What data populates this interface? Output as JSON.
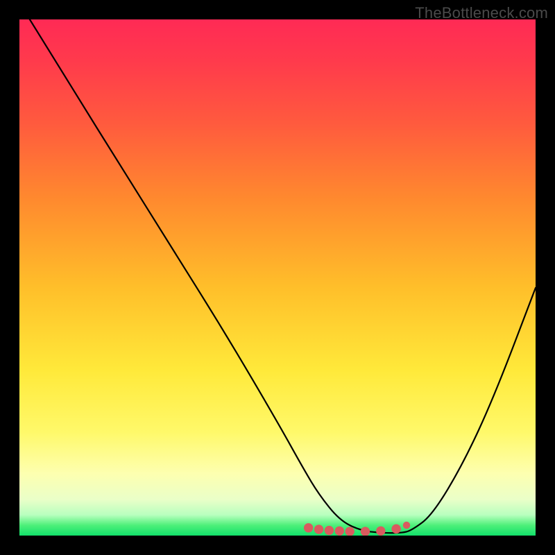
{
  "watermark": "TheBottleneck.com",
  "colors": {
    "frame": "#000000",
    "curve": "#000000",
    "marker_fill": "#d95b5f",
    "marker_stroke": "#d95b5f",
    "gradient_top": "#ff2a55",
    "gradient_bottom": "#12e06a"
  },
  "chart_data": {
    "type": "line",
    "title": "",
    "xlabel": "",
    "ylabel": "",
    "xlim": [
      0,
      100
    ],
    "ylim": [
      0,
      100
    ],
    "grid": false,
    "legend": false,
    "series": [
      {
        "name": "curve",
        "x": [
          2,
          10,
          20,
          30,
          40,
          50,
          55,
          58,
          62,
          66,
          70,
          74,
          76,
          80,
          86,
          92,
          100
        ],
        "y": [
          100,
          87,
          71,
          55,
          39,
          22,
          13,
          8,
          3,
          1,
          0.5,
          0.5,
          1,
          4,
          14,
          27,
          48
        ],
        "stroke": "#000000"
      }
    ],
    "markers": {
      "name": "dotted-bottom",
      "x": [
        56,
        58,
        60,
        62,
        64,
        67,
        70,
        73,
        75
      ],
      "y": [
        1.5,
        1.2,
        1.0,
        0.9,
        0.8,
        0.8,
        0.9,
        1.3,
        2.0
      ],
      "r_rel": 0.9,
      "last_r_rel": 0.7,
      "fill": "#d95b5f"
    }
  }
}
